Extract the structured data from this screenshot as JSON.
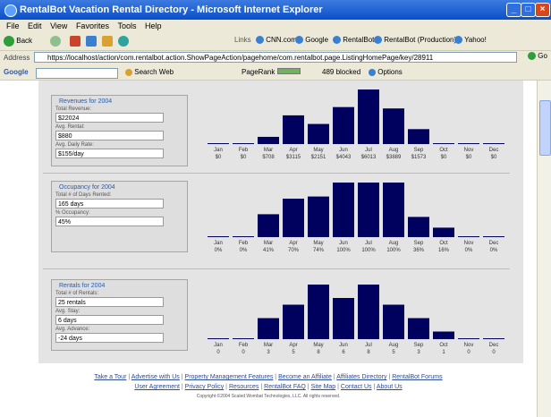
{
  "window": {
    "title": "RentalBot Vacation Rental Directory - Microsoft Internet Explorer",
    "min": "_",
    "max": "□",
    "close": "×"
  },
  "menu": [
    "File",
    "Edit",
    "View",
    "Favorites",
    "Tools",
    "Help"
  ],
  "toolbar": {
    "back": "Back",
    "links_label": "Links",
    "links": [
      "CNN.com",
      "Google",
      "RentalBot",
      "RentalBot (Production)",
      "Yahoo!"
    ]
  },
  "address": {
    "label": "Address",
    "url": "https://localhost/action/com.rentalbot.action.ShowPageAction/pagehome/com.rentalbot.page.ListingHomePage/key/28911",
    "go": "Go"
  },
  "google": {
    "label": "Google",
    "search_web": "Search Web",
    "pagerank": "PageRank",
    "blocked": "489 blocked",
    "options": "Options"
  },
  "sections": [
    {
      "heading": "Revenues for 2004",
      "fields": [
        {
          "label": "Total Revenue:",
          "value": "$22024"
        },
        {
          "label": "Avg. Rental:",
          "value": "$880"
        },
        {
          "label": "Avg. Daily Rate:",
          "value": "$155/day"
        }
      ]
    },
    {
      "heading": "Occupancy for 2004",
      "fields": [
        {
          "label": "Total # of Days Rented:",
          "value": "165 days"
        },
        {
          "label": "% Occupancy:",
          "value": "45%"
        }
      ]
    },
    {
      "heading": "Rentals for 2004",
      "fields": [
        {
          "label": "Total # of Rentals:",
          "value": "25 rentals"
        },
        {
          "label": "Avg. Stay:",
          "value": "6 days"
        },
        {
          "label": "Avg. Advance:",
          "value": "-24 days"
        }
      ]
    }
  ],
  "chart_data": [
    {
      "type": "bar",
      "categories": [
        "Jan",
        "Feb",
        "Mar",
        "Apr",
        "May",
        "Jun",
        "Jul",
        "Aug",
        "Sep",
        "Oct",
        "Nov",
        "Dec"
      ],
      "value_labels": [
        "$0",
        "$0",
        "$708",
        "$3115",
        "$2151",
        "$4043",
        "$6013",
        "$3889",
        "$1573",
        "$0",
        "$0",
        "$0"
      ],
      "values": [
        0,
        0,
        708,
        3115,
        2151,
        4043,
        6013,
        3889,
        1573,
        0,
        0,
        0
      ],
      "ylim": [
        0,
        6013
      ]
    },
    {
      "type": "bar",
      "categories": [
        "Jan",
        "Feb",
        "Mar",
        "Apr",
        "May",
        "Jun",
        "Jul",
        "Aug",
        "Sep",
        "Oct",
        "Nov",
        "Dec"
      ],
      "value_labels": [
        "0%",
        "0%",
        "41%",
        "70%",
        "74%",
        "100%",
        "100%",
        "100%",
        "36%",
        "16%",
        "0%",
        "0%"
      ],
      "values": [
        0,
        0,
        41,
        70,
        74,
        100,
        100,
        100,
        36,
        16,
        0,
        0
      ],
      "ylim": [
        0,
        100
      ]
    },
    {
      "type": "bar",
      "categories": [
        "Jan",
        "Feb",
        "Mar",
        "Apr",
        "May",
        "Jun",
        "Jul",
        "Aug",
        "Sep",
        "Oct",
        "Nov",
        "Dec"
      ],
      "value_labels": [
        "0",
        "0",
        "3",
        "5",
        "8",
        "6",
        "8",
        "5",
        "3",
        "1",
        "0",
        "0"
      ],
      "values": [
        0,
        0,
        3,
        5,
        8,
        6,
        8,
        5,
        3,
        1,
        0,
        0
      ],
      "ylim": [
        0,
        8
      ]
    }
  ],
  "footer": {
    "links_row1": [
      "Take a Tour",
      "Advertise with Us",
      "Property Management Features",
      "Become an Affiliate",
      "Affiliates Directory",
      "RentalBot Forums"
    ],
    "links_row2": [
      "User Agreement",
      "Privacy Policy",
      "Resources",
      "RentalBot FAQ",
      "Site Map",
      "Contact Us",
      "About Us"
    ],
    "copyright": "Copyright ©2004 Scaled Wombat Technologies, LLC. All rights reserved."
  }
}
